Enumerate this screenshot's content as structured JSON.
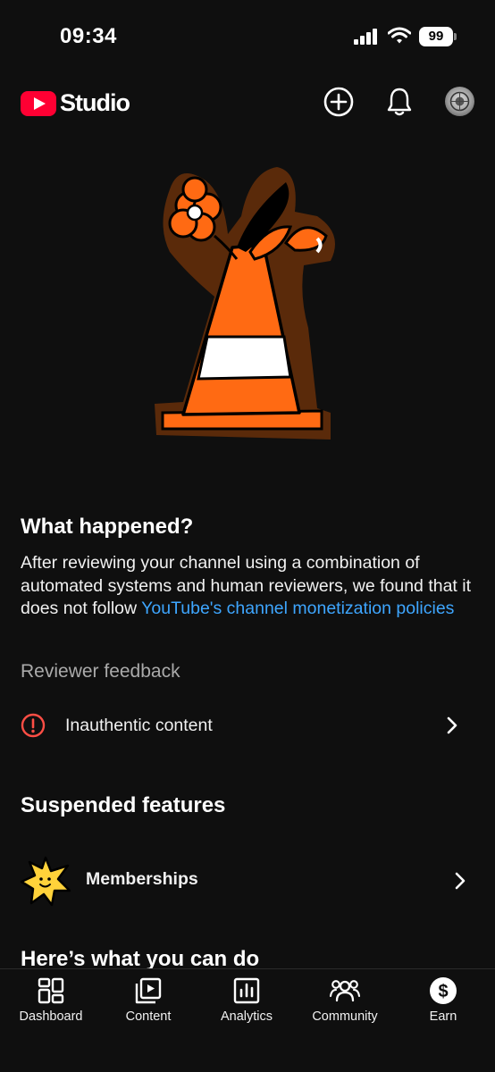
{
  "status_bar": {
    "time": "09:34",
    "battery": "99"
  },
  "header": {
    "app_name": "Studio"
  },
  "what_happened": {
    "title": "What happened?",
    "body": "After reviewing your channel using a combination of automated systems and human reviewers, we found that it does not follow ",
    "link": "YouTube's channel monetization policies"
  },
  "reviewer_feedback": {
    "title": "Reviewer feedback",
    "item": "Inauthentic content"
  },
  "suspended_features": {
    "title": "Suspended features",
    "item": "Memberships"
  },
  "what_you_can_do": {
    "title": "Here’s what you can do"
  },
  "bottom_nav": {
    "items": [
      {
        "label": "Dashboard",
        "icon": "dashboard-icon"
      },
      {
        "label": "Content",
        "icon": "content-icon"
      },
      {
        "label": "Analytics",
        "icon": "analytics-icon"
      },
      {
        "label": "Community",
        "icon": "community-icon"
      },
      {
        "label": "Earn",
        "icon": "earn-icon"
      }
    ]
  },
  "colors": {
    "accent_link": "#3ea6ff",
    "alert_red": "#ff4e45",
    "brand_red": "#ff0033",
    "cone_orange": "#ff6a13"
  }
}
